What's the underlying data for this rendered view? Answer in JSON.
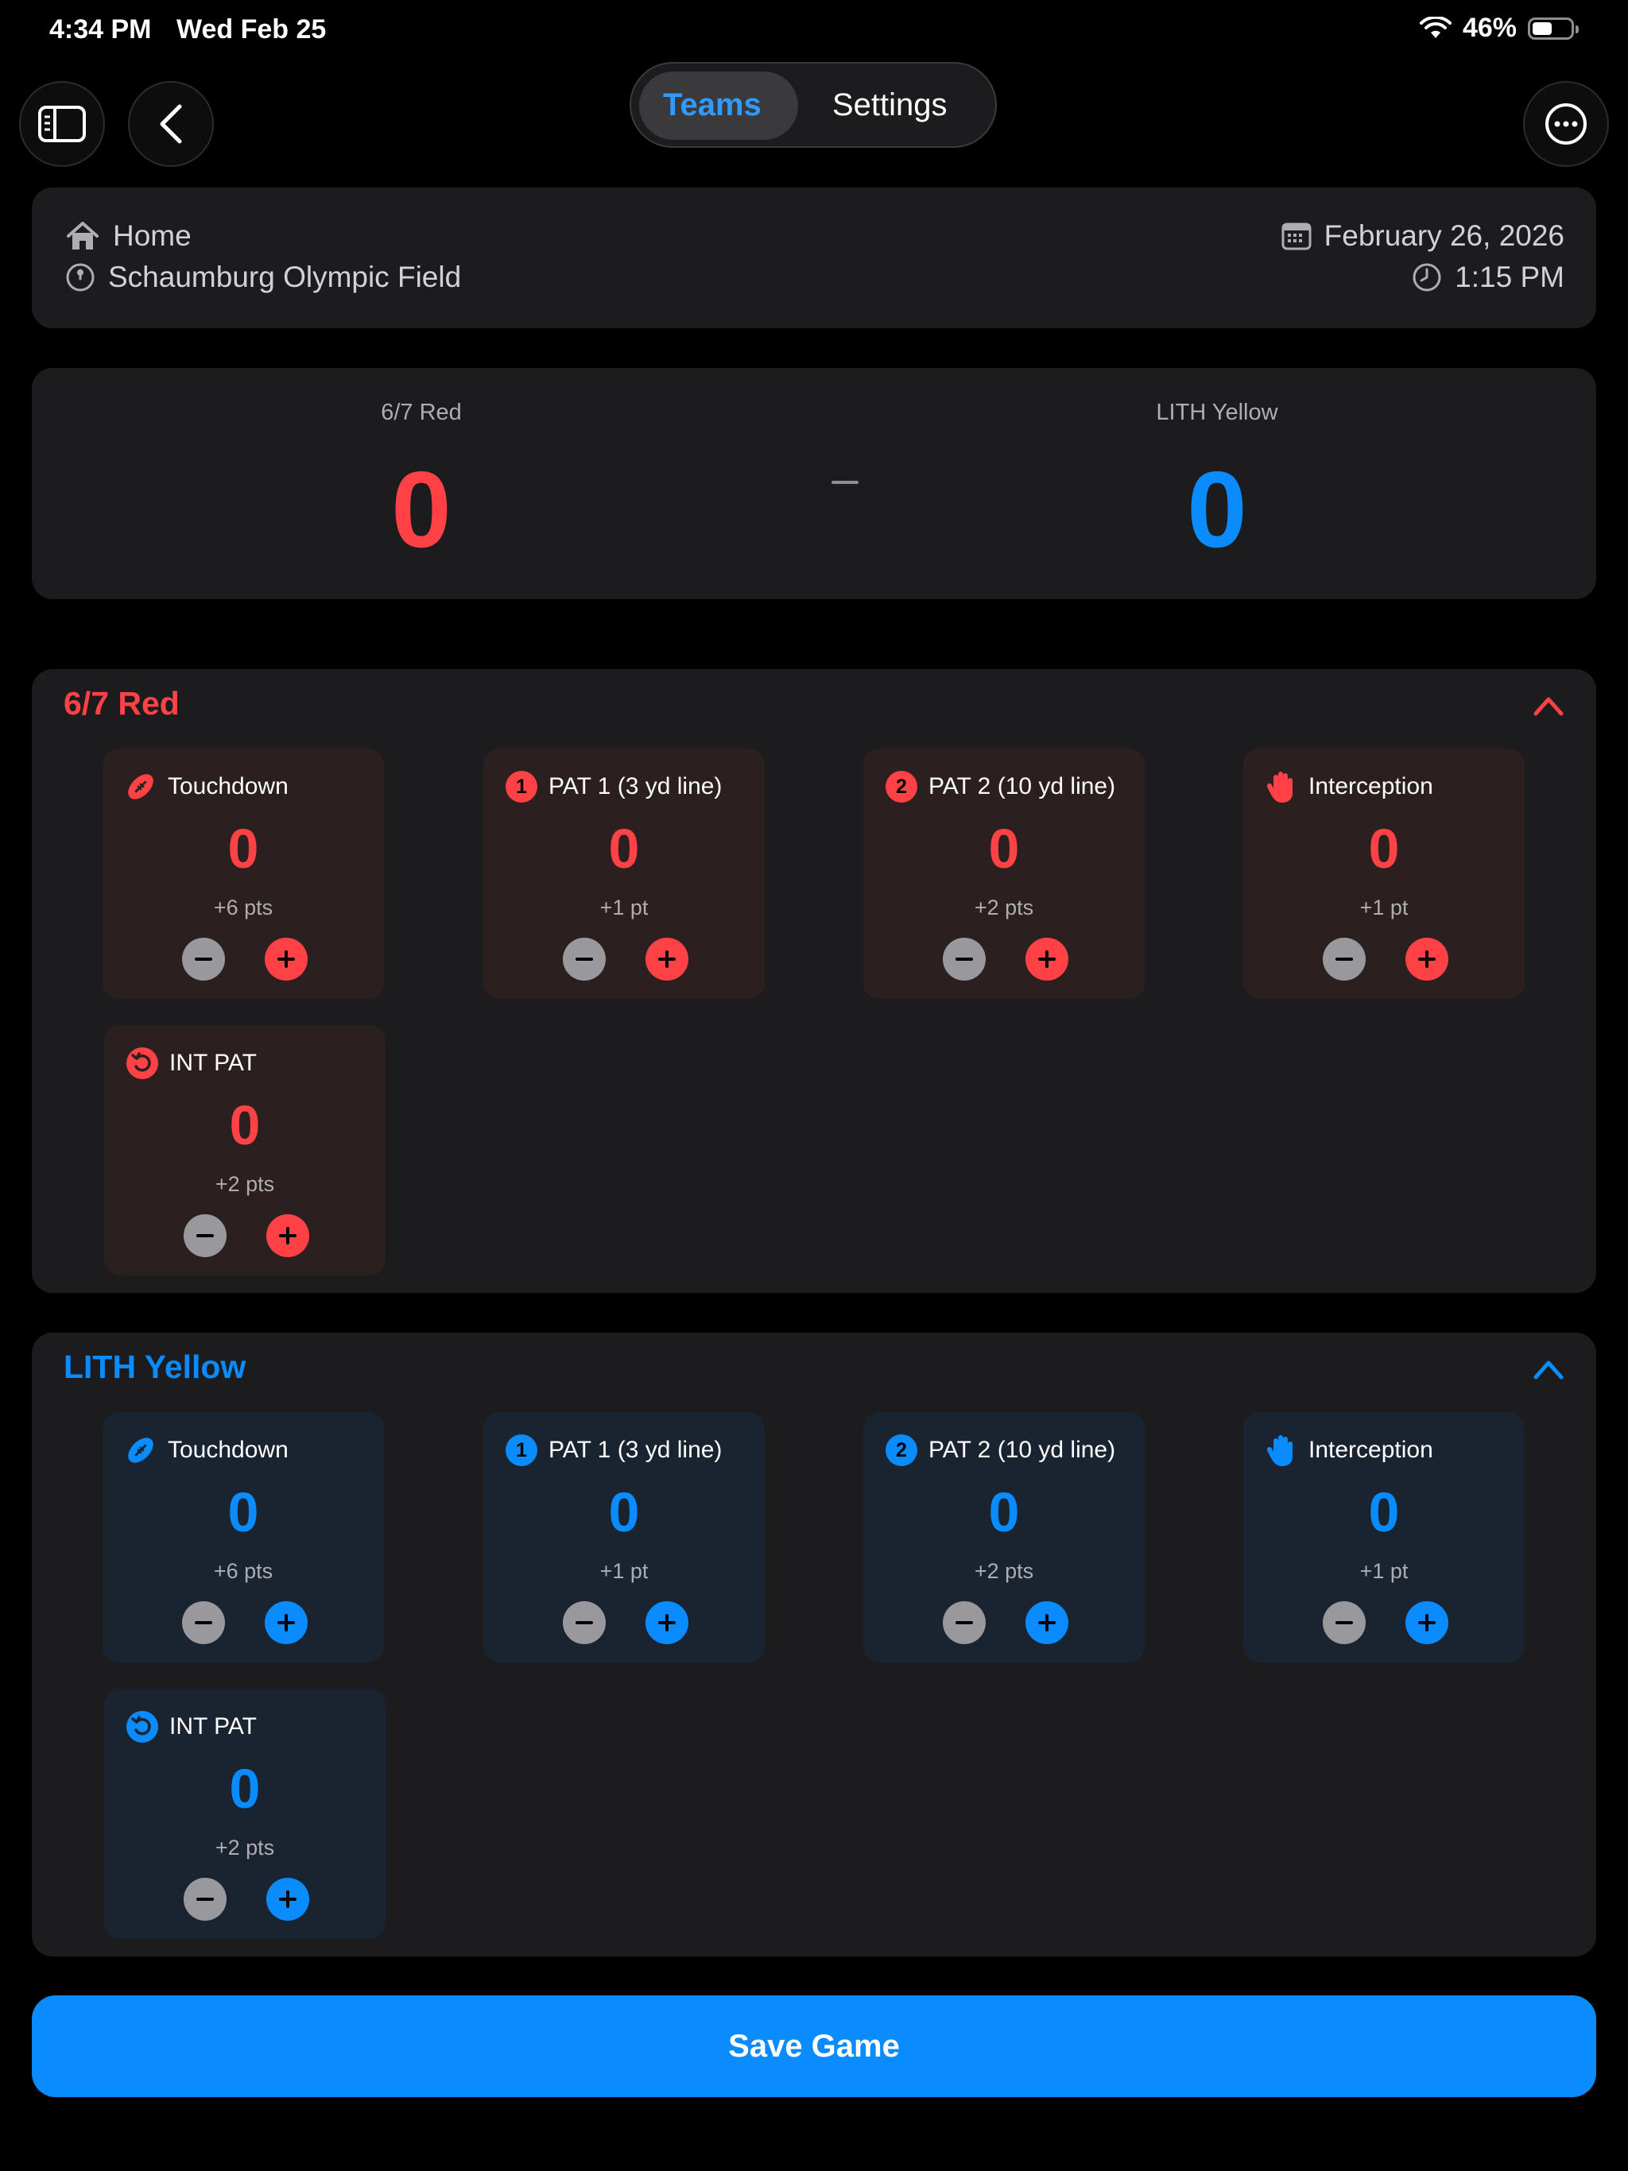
{
  "status": {
    "time": "4:34 PM",
    "date": "Wed Feb 25",
    "battery_percent": "46%",
    "battery_level": 0.46
  },
  "nav": {
    "segments": [
      {
        "label": "Teams",
        "active": true
      },
      {
        "label": "Settings",
        "active": false
      }
    ]
  },
  "game_info": {
    "location_type": "Home",
    "venue": "Schaumburg Olympic Field",
    "date": "February 26, 2026",
    "time": "1:15 PM"
  },
  "scoreboard": {
    "home": {
      "name": "6/7 Red",
      "score": "0"
    },
    "away": {
      "name": "LITH Yellow",
      "score": "0"
    }
  },
  "teams": [
    {
      "name": "6/7 Red",
      "color": "#ff4245",
      "stats": [
        {
          "label": "Touchdown",
          "value": "0",
          "points": "+6 pts",
          "icon": "football-icon"
        },
        {
          "label": "PAT 1 (3 yd line)",
          "value": "0",
          "points": "+1 pt",
          "badge": "1"
        },
        {
          "label": "PAT 2 (10 yd line)",
          "value": "0",
          "points": "+2 pts",
          "badge": "2"
        },
        {
          "label": "Interception",
          "value": "0",
          "points": "+1 pt",
          "icon": "hand-icon"
        },
        {
          "label": "INT PAT",
          "value": "0",
          "points": "+2 pts",
          "icon": "return-arrow-icon"
        }
      ]
    },
    {
      "name": "LITH Yellow",
      "color": "#0a8cff",
      "stats": [
        {
          "label": "Touchdown",
          "value": "0",
          "points": "+6 pts",
          "icon": "football-icon"
        },
        {
          "label": "PAT 1 (3 yd line)",
          "value": "0",
          "points": "+1 pt",
          "badge": "1"
        },
        {
          "label": "PAT 2 (10 yd line)",
          "value": "0",
          "points": "+2 pts",
          "badge": "2"
        },
        {
          "label": "Interception",
          "value": "0",
          "points": "+1 pt",
          "icon": "hand-icon"
        },
        {
          "label": "INT PAT",
          "value": "0",
          "points": "+2 pts",
          "icon": "return-arrow-icon"
        }
      ]
    }
  ],
  "actions": {
    "save_label": "Save Game"
  }
}
